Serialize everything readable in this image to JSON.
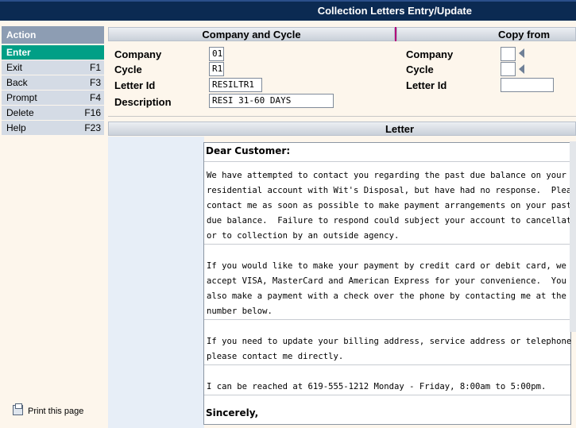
{
  "window": {
    "title": "Collection Letters Entry/Update"
  },
  "menu": {
    "header": "Action",
    "items": [
      {
        "label": "Enter",
        "key": ""
      },
      {
        "label": "Exit",
        "key": "F1"
      },
      {
        "label": "Back",
        "key": "F3"
      },
      {
        "label": "Prompt",
        "key": "F4"
      },
      {
        "label": "Delete",
        "key": "F16"
      },
      {
        "label": "Help",
        "key": "F23"
      }
    ],
    "print_label": "Print this page"
  },
  "company_cycle": {
    "header": "Company and Cycle",
    "company_label": "Company",
    "company_value": "01",
    "cycle_label": "Cycle",
    "cycle_value": "R1",
    "letter_id_label": "Letter Id",
    "letter_id_value": "RESILTR1",
    "description_label": "Description",
    "description_value": "RESI 31-60 DAYS"
  },
  "copy_from": {
    "header": "Copy from",
    "company_label": "Company",
    "company_value": "",
    "cycle_label": "Cycle",
    "cycle_value": "",
    "letter_id_label": "Letter Id",
    "letter_id_value": ""
  },
  "letter": {
    "header": "Letter",
    "greeting": "Dear Customer:",
    "paragraph1": "We have attempted to contact you regarding the past due balance on your\nresidential account with Wit's Disposal, but have had no response.  Please\ncontact me as soon as possible to make payment arrangements on your past\ndue balance.  Failure to respond could subject your account to cancellation\nor to collection by an outside agency.",
    "paragraph2": "If you would like to make your payment by credit card or debit card, we\naccept VISA, MasterCard and American Express for your convenience.  You can\nalso make a payment with a check over the phone by contacting me at the\nnumber below.",
    "paragraph3": "If you need to update your billing address, service address or telephone #,\nplease contact me directly.",
    "paragraph4": "I can be reached at 619-555-1212 Monday - Friday, 8:00am to 5:00pm.",
    "closing": "Sincerely,"
  }
}
